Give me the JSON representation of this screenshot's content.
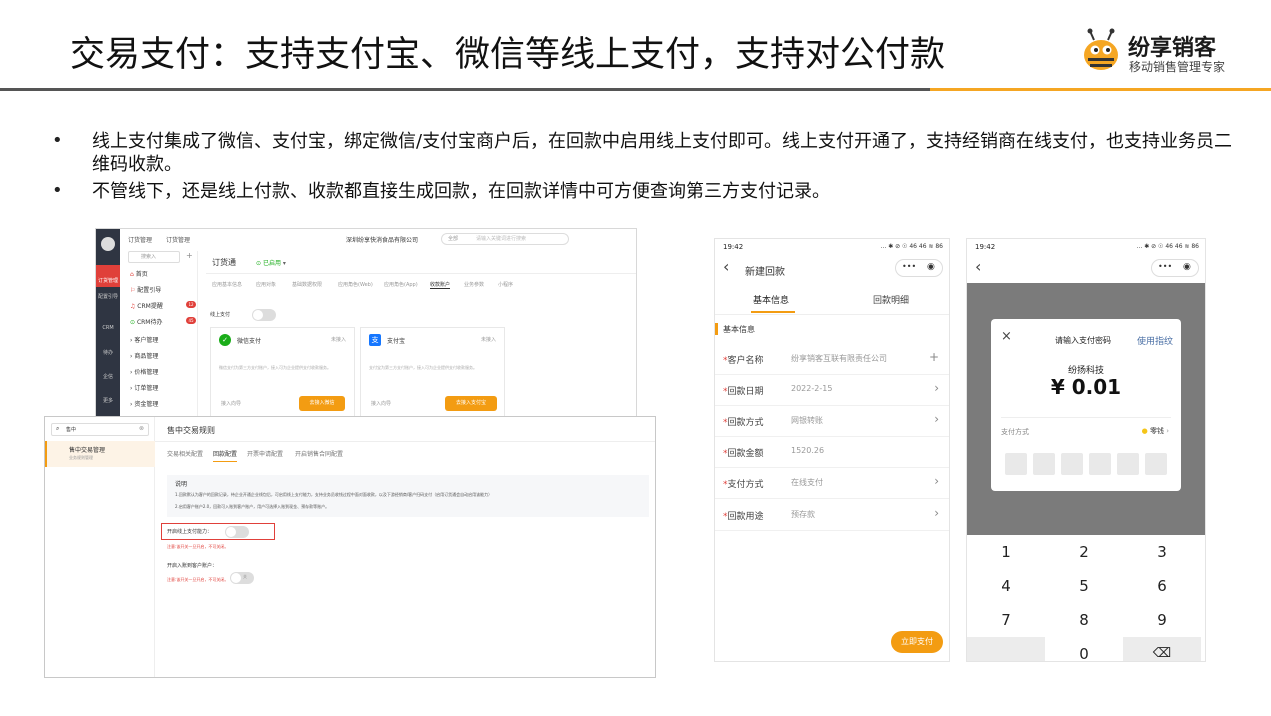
{
  "slide": {
    "title": "交易支付：支持支付宝、微信等线上支付，支持对公付款",
    "logo": {
      "name": "纷享销客",
      "tagline": "移动销售管理专家"
    },
    "bullets": [
      {
        "marker": "•",
        "text": "线上支付集成了微信、支付宝，绑定微信/支付宝商户后，在回款中启用线上支付即可。线上支付开通了，支持经销商在线支付，也支持业务员二维码收款。"
      },
      {
        "marker": "•",
        "text": "不管线下，还是线上付款、收款都直接生成回款，在回款详情中可方便查询第三方支付记录。"
      }
    ]
  },
  "admin": {
    "top_tabs": [
      "订货管理",
      "订货管理"
    ],
    "company": "深圳纷享快消食品有限公司",
    "search_scope": "全部",
    "search_placeholder": "请输入关键词进行搜索",
    "side_icons": [
      {
        "icon": "cube-icon",
        "label": "订货管理"
      },
      {
        "icon": "cube-icon",
        "label": "配置引导"
      },
      {
        "icon": "crm-icon",
        "label": "CRM"
      },
      {
        "icon": "todo-icon",
        "label": "待办"
      },
      {
        "icon": "chat-icon",
        "label": "企信"
      },
      {
        "icon": "grid-icon",
        "label": "更多"
      }
    ],
    "menu_search_placeholder": "搜索入",
    "menu": [
      "首页",
      "配置引导",
      "CRM提醒",
      "CRM待办",
      "客户管理",
      "商品管理",
      "价格管理",
      "订单管理",
      "资金管理"
    ],
    "menu_badges": {
      "crm_remind": "12",
      "crm_todo": "45"
    },
    "app_title": "订货通",
    "app_status": "已启用",
    "sub_tabs": [
      "应用基本信息",
      "应用对象",
      "基础数据权限",
      "应用角色(Web)",
      "应用角色(App)",
      "收款账户",
      "业务参数",
      "小程序"
    ],
    "online_pay_label": "线上支付",
    "cards": [
      {
        "name": "微信支付",
        "status": "未接入",
        "desc": "微信支付为第三方支付账户，接入可为企业提供支付收款服务。",
        "guide": "接入向导",
        "button": "去接入微信"
      },
      {
        "name": "支付宝",
        "status": "未接入",
        "desc": "支付宝为第三方支付账户，接入可为企业提供支付收款服务。",
        "guide": "接入向导",
        "button": "去接入支付宝"
      }
    ]
  },
  "rules": {
    "search_value": "售中",
    "side_title": "售中交易管理",
    "side_sub": "业务规则管理",
    "title": "售中交易规则",
    "tabs": [
      "交易相关配置",
      "回款配置",
      "开票申请配置",
      "开启销售合同配置"
    ],
    "info_title": "说明",
    "info_lines": [
      "1.回款默认为客户的回款记录，待企业开通企业线包后，可启用线上支付能力，支持业务员收钱过程中面对面收款，以及下游经销商/客户扫码支付（启用订货通会自动启用该能力）",
      "2.启用客户账户2.0，回款可入账到客户账户，用户可选择入账到现金、预存款等账户。"
    ],
    "opt1_label": "开启线上支付能力：",
    "opt1_note": "注意:该开关一旦开启，不可关闭。",
    "opt2_label": "开启入账到客户账户：",
    "opt2_state": "关",
    "opt2_note": "注意:该开关一旦开启，不可关闭。"
  },
  "mobile1": {
    "time": "19:42",
    "status_icons": "... ✱ ⊘ ☉ 46 46 ≋ 86",
    "nav_title": "新建回款",
    "capsule": "•••",
    "tabs": [
      "基本信息",
      "回款明细"
    ],
    "section": "基本信息",
    "rows": [
      {
        "label": "客户名称",
        "value": "纷享销客互联有限责任公司",
        "action": "+"
      },
      {
        "label": "回款日期",
        "value": "2022-2-15",
        "action": "›"
      },
      {
        "label": "回款方式",
        "value": "网银转账",
        "action": "›"
      },
      {
        "label": "回款金额",
        "value": "1520.26",
        "action": ""
      },
      {
        "label": "支付方式",
        "value": "在线支付",
        "action": "›"
      },
      {
        "label": "回款用途",
        "value": "预存款",
        "action": "›"
      }
    ],
    "required_mark": "*",
    "pay_button": "立即支付"
  },
  "mobile2": {
    "time": "19:42",
    "status_icons": "... ✱ ⊘ ☉ 46 46 ≋ 86",
    "capsule": "•••",
    "dialog_title": "请输入支付密码",
    "fingerprint_link": "使用指纹",
    "payee": "纷扬科技",
    "amount": "¥ 0.01",
    "method_label": "支付方式",
    "method_value": "零钱",
    "keys": [
      "1",
      "2",
      "3",
      "4",
      "5",
      "6",
      "7",
      "8",
      "9",
      "",
      "0",
      "⌫"
    ]
  },
  "colors": {
    "accent": "#f5a623",
    "orange_button": "#f39c12",
    "wechat_green": "#1aad19",
    "alipay_blue": "#1677ff",
    "link_blue": "#4a6fa5",
    "red_highlight": "#e0403a"
  }
}
